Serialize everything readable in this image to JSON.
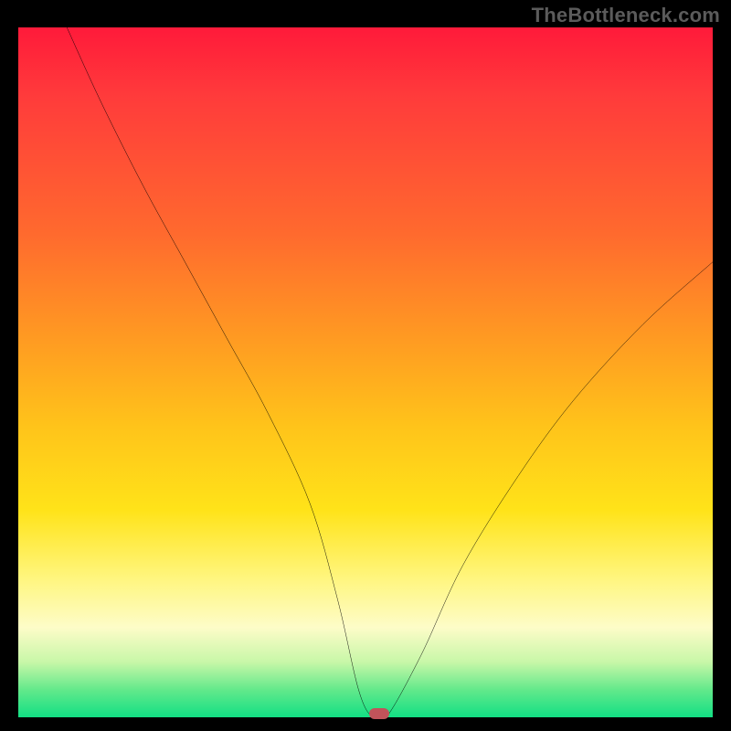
{
  "watermark": "TheBottleneck.com",
  "chart_data": {
    "type": "line",
    "title": "",
    "xlabel": "",
    "ylabel": "",
    "xlim": [
      0,
      100
    ],
    "ylim": [
      0,
      100
    ],
    "grid": false,
    "legend": false,
    "background_gradient": [
      "#ff1a3a",
      "#ff9a22",
      "#ffe319",
      "#12df84"
    ],
    "series": [
      {
        "name": "bottleneck-curve",
        "x": [
          7,
          12,
          18,
          24,
          30,
          36,
          42,
          46,
          49,
          51,
          53,
          58,
          64,
          72,
          80,
          90,
          100
        ],
        "values": [
          100,
          89,
          77,
          66,
          55,
          44,
          31,
          17,
          4,
          0,
          0,
          9,
          22,
          35,
          46,
          57,
          66
        ]
      }
    ],
    "marker": {
      "x": 52,
      "y": 0,
      "shape": "pill",
      "color": "#c1535a"
    }
  }
}
